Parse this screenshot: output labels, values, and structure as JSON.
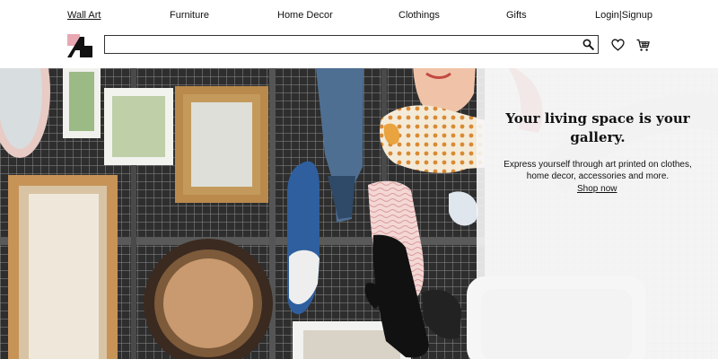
{
  "nav": {
    "items": [
      {
        "label": "Wall Art",
        "active": true
      },
      {
        "label": "Furniture",
        "active": false
      },
      {
        "label": "Home Decor",
        "active": false
      },
      {
        "label": "Clothings",
        "active": false
      },
      {
        "label": "Gifts",
        "active": false
      }
    ],
    "login": "Login",
    "separator": "|",
    "signup": "Signup"
  },
  "search": {
    "placeholder": "",
    "value": ""
  },
  "icons": {
    "logo": "brand-logo",
    "search": "search-icon",
    "wishlist": "heart-icon",
    "cart": "cart-icon"
  },
  "hero": {
    "title": "Your living space is your gallery.",
    "subtitle": "Express yourself through art printed on clothes, home decor, accessories and more.",
    "cta": "Shop now"
  },
  "colors": {
    "logo_pink": "#e8a8b3",
    "text": "#111111",
    "overlay": "#f6f6f6"
  }
}
